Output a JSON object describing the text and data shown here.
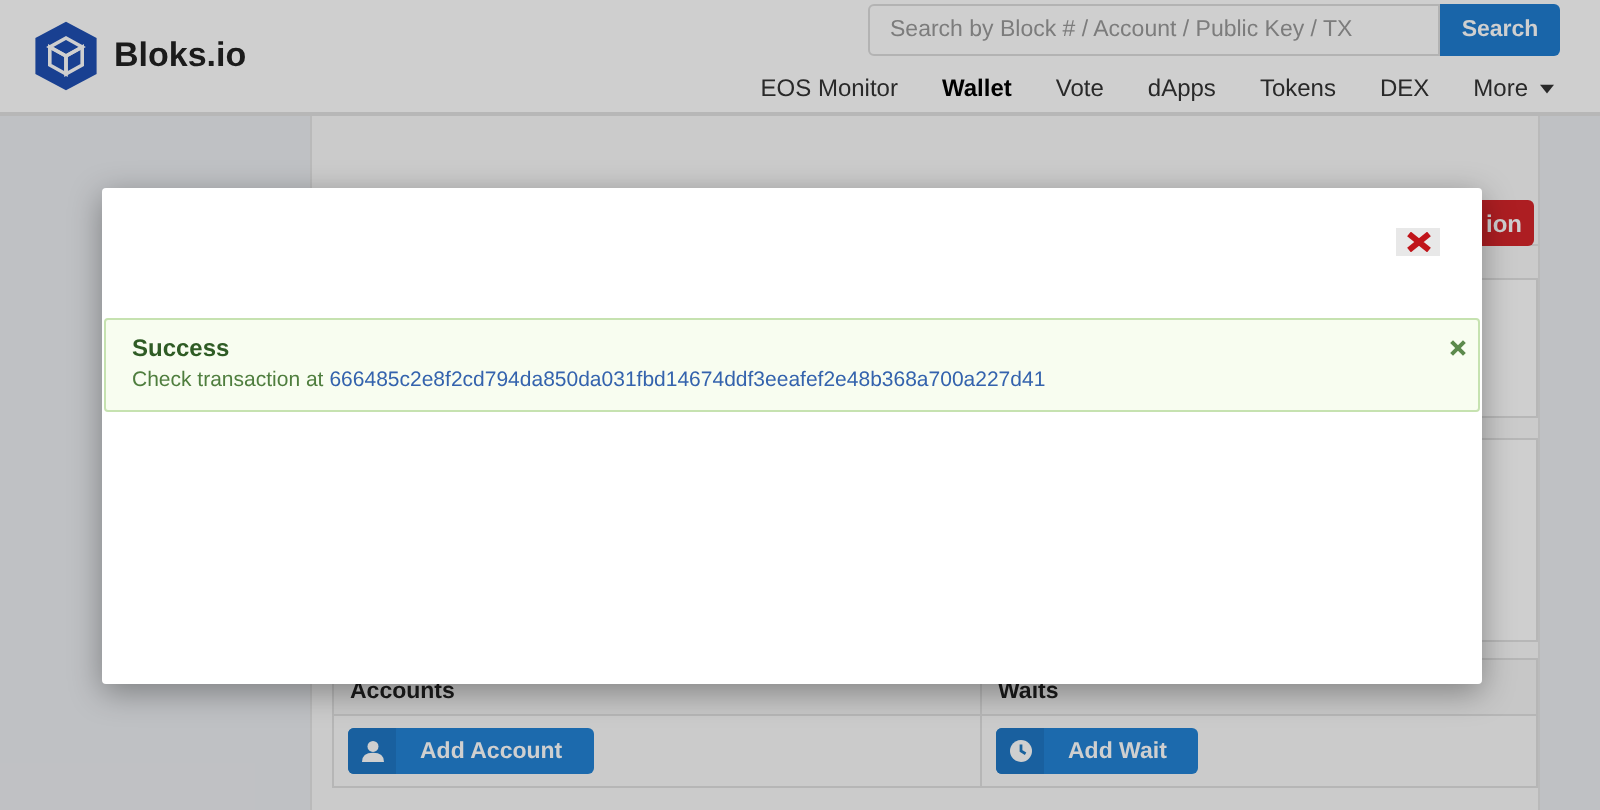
{
  "header": {
    "logo": "Bloks.io",
    "search": {
      "placeholder": "Search by Block # / Account / Public Key / TX",
      "button": "Search"
    },
    "nav": [
      {
        "label": "EOS Monitor",
        "selected": false
      },
      {
        "label": "Wallet",
        "selected": true
      },
      {
        "label": "Vote",
        "selected": false
      },
      {
        "label": "dApps",
        "selected": false
      },
      {
        "label": "Tokens",
        "selected": false
      },
      {
        "label": "DEX",
        "selected": false
      },
      {
        "label": "More",
        "selected": false
      }
    ]
  },
  "page": {
    "action_button": "ion",
    "sections": [
      {
        "title": "Accounts",
        "button": "Add Account",
        "kind": "user"
      },
      {
        "title": "Waits",
        "button": "Add Wait",
        "kind": "clock"
      }
    ]
  },
  "modal": {
    "alert": {
      "title": "Success",
      "text": "Check transaction at",
      "link": "666485c2e8f2cd794da850da031fbd14674ddf3eeafef2e48b368a700a227d41"
    }
  }
}
